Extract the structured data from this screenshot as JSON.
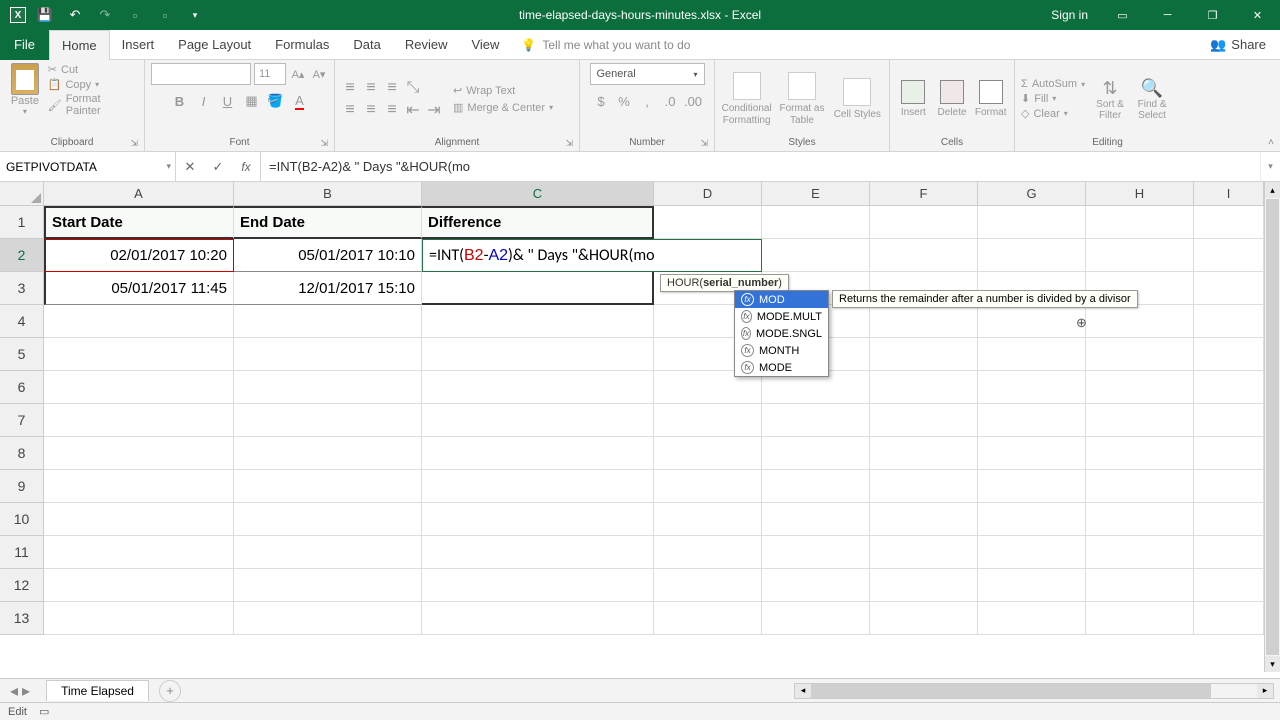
{
  "app": {
    "title": "time-elapsed-days-hours-minutes.xlsx - Excel",
    "signin": "Sign in"
  },
  "qat": {
    "save": "💾",
    "undo": "↶",
    "redo": "↷"
  },
  "tabs": {
    "file": "File",
    "home": "Home",
    "insert": "Insert",
    "page_layout": "Page Layout",
    "formulas": "Formulas",
    "data": "Data",
    "review": "Review",
    "view": "View",
    "tell_me": "Tell me what you want to do",
    "share": "Share"
  },
  "ribbon": {
    "clipboard": {
      "label": "Clipboard",
      "paste": "Paste",
      "cut": "Cut",
      "copy": "Copy",
      "painter": "Format Painter"
    },
    "font": {
      "label": "Font",
      "size": "11"
    },
    "alignment": {
      "label": "Alignment",
      "wrap": "Wrap Text",
      "merge": "Merge & Center"
    },
    "number": {
      "label": "Number",
      "format": "General"
    },
    "styles": {
      "label": "Styles",
      "cond": "Conditional Formatting",
      "table": "Format as Table",
      "cell": "Cell Styles"
    },
    "cells": {
      "label": "Cells",
      "insert": "Insert",
      "delete": "Delete",
      "format": "Format"
    },
    "editing": {
      "label": "Editing",
      "autosum": "AutoSum",
      "fill": "Fill",
      "clear": "Clear",
      "sort": "Sort & Filter",
      "find": "Find & Select"
    }
  },
  "formula_bar": {
    "name_box": "GETPIVOTDATA",
    "formula": "=INT(B2-A2)& \" Days \"&HOUR(mo"
  },
  "columns": [
    "A",
    "B",
    "C",
    "D",
    "E",
    "F",
    "G",
    "H",
    "I"
  ],
  "col_widths": {
    "A": 190,
    "B": 188,
    "C": 232,
    "D": 108,
    "E": 108,
    "F": 108,
    "G": 108,
    "H": 108,
    "I": 70
  },
  "row_count": 13,
  "headers": {
    "A1": "Start Date",
    "B1": "End Date",
    "C1": "Difference"
  },
  "data": {
    "A2": "02/01/2017 10:20",
    "B2": "05/01/2017 10:10",
    "A3": "05/01/2017 11:45",
    "B3": "12/01/2017 15:10"
  },
  "active_cell": {
    "formula_display": "=INT(B2-A2)& \" Days \"&HOUR(mo",
    "b2": "B2",
    "a2": "A2"
  },
  "tooltip": {
    "text_prefix": "HOUR(",
    "text_bold": "serial_number",
    "text_suffix": ")"
  },
  "autocomplete": {
    "items": [
      "MOD",
      "MODE.MULT",
      "MODE.SNGL",
      "MONTH",
      "MODE"
    ],
    "selected": 0,
    "desc": "Returns the remainder after a number is divided by a divisor"
  },
  "sheet": {
    "name": "Time Elapsed"
  },
  "status": {
    "mode": "Edit"
  }
}
